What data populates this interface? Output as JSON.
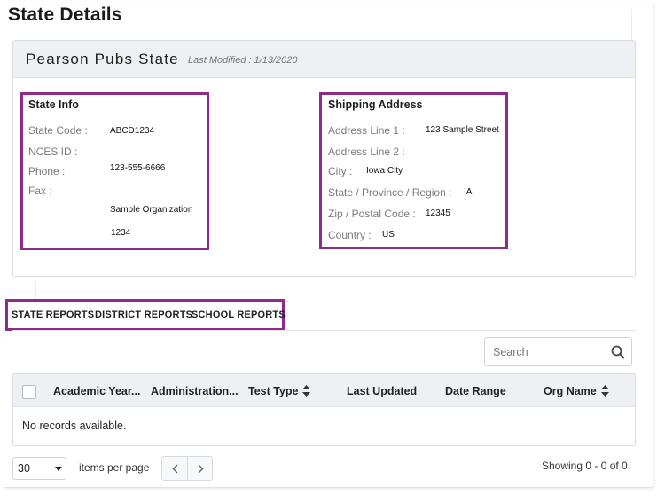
{
  "page": {
    "title": "State Details"
  },
  "card": {
    "name": "Pearson Pubs State",
    "last_modified": "Last Modified : 1/13/2020"
  },
  "state_info": {
    "title": "State Info",
    "state_code_label": "State Code :",
    "state_code_value": "ABCD1234",
    "nces_label": "NCES ID :",
    "phone_label": "Phone :",
    "phone_value": "123-555-6666",
    "fax_label": "Fax :",
    "org_value": "Sample Organization",
    "extra_value": "1234"
  },
  "shipping": {
    "title": "Shipping Address",
    "addr1_label": "Address Line 1 :",
    "addr1_value": "123 Sample Street",
    "addr2_label": "Address Line 2 :",
    "city_label": "City :",
    "city_value": "Iowa City",
    "state_label": "State / Province / Region :",
    "state_value": "IA",
    "zip_label": "Zip / Postal Code :",
    "zip_value": "12345",
    "country_label": "Country :",
    "country_value": "US"
  },
  "tabs": [
    "STATE REPORTS",
    "DISTRICT REPORTS",
    "SCHOOL REPORTS"
  ],
  "search": {
    "placeholder": "Search"
  },
  "table": {
    "columns": [
      "Academic Year...",
      "Administration...",
      "Test Type",
      "Last Updated",
      "Date Range",
      "Org Name"
    ],
    "empty_message": "No records available."
  },
  "pager": {
    "page_size": "30",
    "items_per_page_label": "items per page",
    "showing_text": "Showing 0 - 0 of 0"
  },
  "colors": {
    "highlight": "#8e2a8b",
    "header_bg": "#eef0f3"
  },
  "icons": [
    "search-icon",
    "sort-icon",
    "chevron-left-icon",
    "chevron-right-icon",
    "chevron-down-icon"
  ]
}
